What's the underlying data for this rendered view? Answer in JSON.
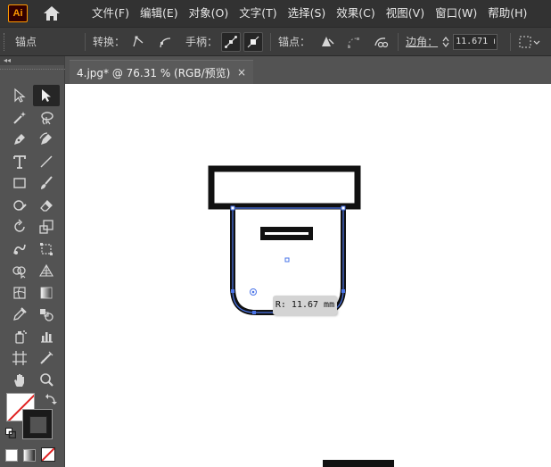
{
  "app": {
    "logo_text": "Ai"
  },
  "menu": {
    "items": [
      "文件(F)",
      "编辑(E)",
      "对象(O)",
      "文字(T)",
      "选择(S)",
      "效果(C)",
      "视图(V)",
      "窗口(W)",
      "帮助(H)"
    ]
  },
  "controlbar": {
    "anchor_label": "锚点",
    "convert_label": "转换：",
    "handles_label": "手柄：",
    "anchors_label": "锚点：",
    "corner_label": "边角：",
    "corner_value": "11.671 n"
  },
  "toolbar": {
    "collapse_glyph": "◂◂"
  },
  "document": {
    "tab_title": "4.jpg* @ 76.31 % (RGB/预览)",
    "close_glyph": "×"
  },
  "canvas": {
    "measure_tooltip": "R: 11.67 mm"
  },
  "colors": {
    "selection": "#4a74e8",
    "artwork": "#111111",
    "canvas_bg": "#ffffff",
    "ui_dark": "#323232",
    "ui_mid": "#535353"
  }
}
